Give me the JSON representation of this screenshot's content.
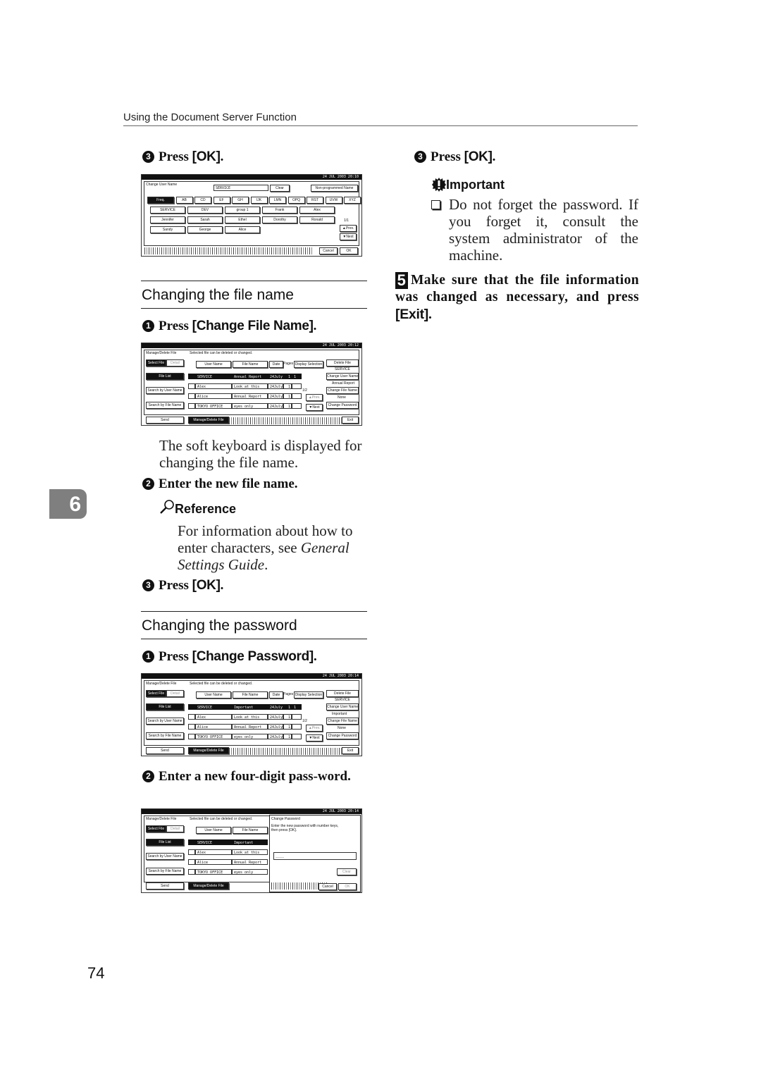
{
  "header": {
    "title": "Using the Document Server Function"
  },
  "chapter_tab": "6",
  "page_number": "74",
  "left_column": {
    "step_top": {
      "num": "3",
      "prefix": "Press ",
      "button": "[OK]",
      "suffix": "."
    },
    "screen_change_user": {
      "datetime": "24  JUL   2003 20:10",
      "title": "Change User Name",
      "input_value": "SERVICE",
      "clear": "Clear",
      "non_programmed": "Non-programmed Name",
      "tabs": [
        "Freq.",
        "AB",
        "CD",
        "EF",
        "GH",
        "IJK",
        "LMN",
        "OPQ",
        "RST",
        "UVW",
        "XYZ"
      ],
      "names": [
        "SERVICE",
        "DEV",
        "group 1",
        "Frank",
        "Alex",
        "Jennifer",
        "Sarah",
        "Ethel",
        "Dorothy",
        "Ronald",
        "Sandy",
        "George",
        "Alice"
      ],
      "page": "1/1",
      "prev": "▲Prev.",
      "next": "▼Next",
      "cancel": "Cancel",
      "ok": "OK"
    },
    "section_file_name": {
      "title": "Changing the file name",
      "step1": {
        "num": "1",
        "prefix": "Press ",
        "button": "[Change File Name]",
        "suffix": "."
      },
      "screen": {
        "datetime": "24  JUL   2003 20:12",
        "title": "Manage/Delete File",
        "message": "Selected file can be deleted or changed.",
        "select_file": "Select File",
        "detail": "Detail",
        "file_list": "File List",
        "search_user": "Search by User Name",
        "search_file": "Search by File Name",
        "col_user": "User Name",
        "col_file": "File Name",
        "col_date": "Date",
        "col_pages": "Pages",
        "display_selection": "Display Selection",
        "rows": [
          {
            "user": "SERVICE",
            "file": "Annual Report",
            "date": "24July",
            "pages": "1",
            "sel": "1"
          },
          {
            "user": "Alex",
            "file": "Look at this",
            "date": "24July",
            "pages": "1",
            "sel": ""
          },
          {
            "user": "Alice",
            "file": "Annual Report",
            "date": "24July",
            "pages": "1",
            "sel": ""
          },
          {
            "user": "TOKYO OFFICE",
            "file": "eyes only",
            "date": "24July",
            "pages": "1",
            "sel": ""
          }
        ],
        "page": "1/2",
        "prev": "▲Prev.",
        "next": "▼Next",
        "delete_file": "Delete File",
        "cur_user": "SERVICE",
        "change_user": "Change User Name",
        "cur_file": "Annual Report",
        "change_file": "Change File Name",
        "cur_pw": "None",
        "change_pw": "Change Password",
        "send": "Send",
        "manage": "Manage/Delete File",
        "exit": "Exit"
      },
      "note": "The soft keyboard is displayed for changing the file name.",
      "step2": {
        "num": "2",
        "text": "Enter the new file name."
      },
      "reference": {
        "heading": "Reference",
        "text_plain": "For information about how to enter characters, see ",
        "text_italic": "General Settings Guide",
        "text_end": "."
      },
      "step3": {
        "num": "3",
        "prefix": "Press ",
        "button": "[OK]",
        "suffix": "."
      }
    },
    "section_password": {
      "title": "Changing the password",
      "step1": {
        "num": "1",
        "prefix": "Press ",
        "button": "[Change Password]",
        "suffix": "."
      },
      "screen": {
        "datetime": "24  JUL   2003 20:14",
        "title": "Manage/Delete File",
        "message": "Selected file can be deleted or changed.",
        "select_file": "Select File",
        "detail": "Detail",
        "file_list": "File List",
        "search_user": "Search by User Name",
        "search_file": "Search by File Name",
        "col_user": "User Name",
        "col_file": "File Name",
        "col_date": "Date",
        "col_pages": "Pages",
        "display_selection": "Display Selection",
        "rows": [
          {
            "user": "SERVICE",
            "file": "Important",
            "date": "24July",
            "pages": "1",
            "sel": "1"
          },
          {
            "user": "Alex",
            "file": "Look at this",
            "date": "24July",
            "pages": "1",
            "sel": ""
          },
          {
            "user": "Alice",
            "file": "Annual Report",
            "date": "24July",
            "pages": "1",
            "sel": ""
          },
          {
            "user": "TOKYO OFFICE",
            "file": "eyes only",
            "date": "24July",
            "pages": "1",
            "sel": ""
          }
        ],
        "page": "1/2",
        "prev": "▲Prev.",
        "next": "▼Next",
        "delete_file": "Delete File",
        "cur_user": "SERVICE",
        "change_user": "Change User Name",
        "cur_file": "Important",
        "change_file": "Change File Name",
        "cur_pw": "None",
        "change_pw": "Change Password",
        "send": "Send",
        "manage": "Manage/Delete File",
        "exit": "Exit"
      },
      "step2": {
        "num": "2",
        "text": "Enter a new four-digit pass-word."
      },
      "screen_dialog": {
        "datetime": "24  JUL   2003 20:14",
        "dialog_title": "Change Password",
        "dialog_msg1": "Enter the new password with number keys,",
        "dialog_msg2": "then press [OK].",
        "password_value": "____",
        "clear": "Clear",
        "cancel": "Cancel",
        "ok": "OK"
      }
    }
  },
  "right_column": {
    "step3": {
      "num": "3",
      "prefix": "Press ",
      "button": "[OK]",
      "suffix": "."
    },
    "important": {
      "heading": "Important",
      "text": "Do not forget the password. If you forget it, consult the system administrator of the machine."
    },
    "step5": {
      "num": "5",
      "text": "Make sure that the file information was changed as necessary, and press ",
      "button": "[Exit]",
      "suffix": "."
    }
  }
}
